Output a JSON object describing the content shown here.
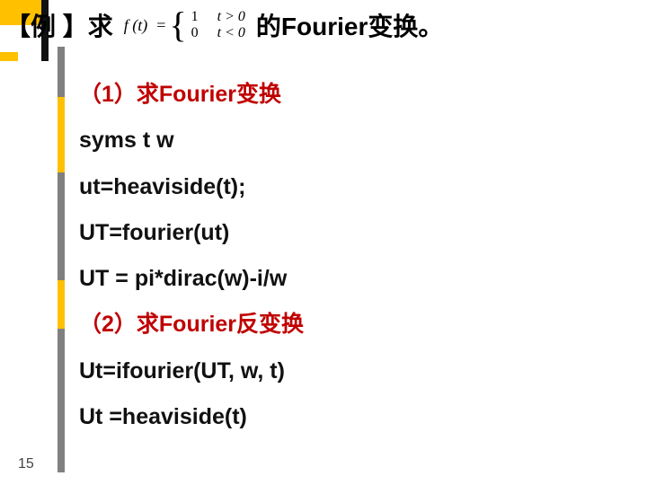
{
  "title": {
    "prefix": "【例  】求",
    "suffix": "的Fourier变换。",
    "formula": {
      "lhs": "f (t)",
      "eq": "=",
      "case1_val": "1",
      "case1_cond": "t > 0",
      "case2_val": "0",
      "case2_cond": "t < 0"
    }
  },
  "body": {
    "h1": "（1）求Fourier变换",
    "l1": "syms  t  w",
    "l2": "ut=heaviside(t);",
    "l3": "UT=fourier(ut)",
    "l4": "UT = pi*dirac(w)-i/w",
    "h2": "（2）求Fourier反变换",
    "l5": "Ut=ifourier(UT, w, t)",
    "l6": "Ut =heaviside(t)"
  },
  "slide_number": "15"
}
